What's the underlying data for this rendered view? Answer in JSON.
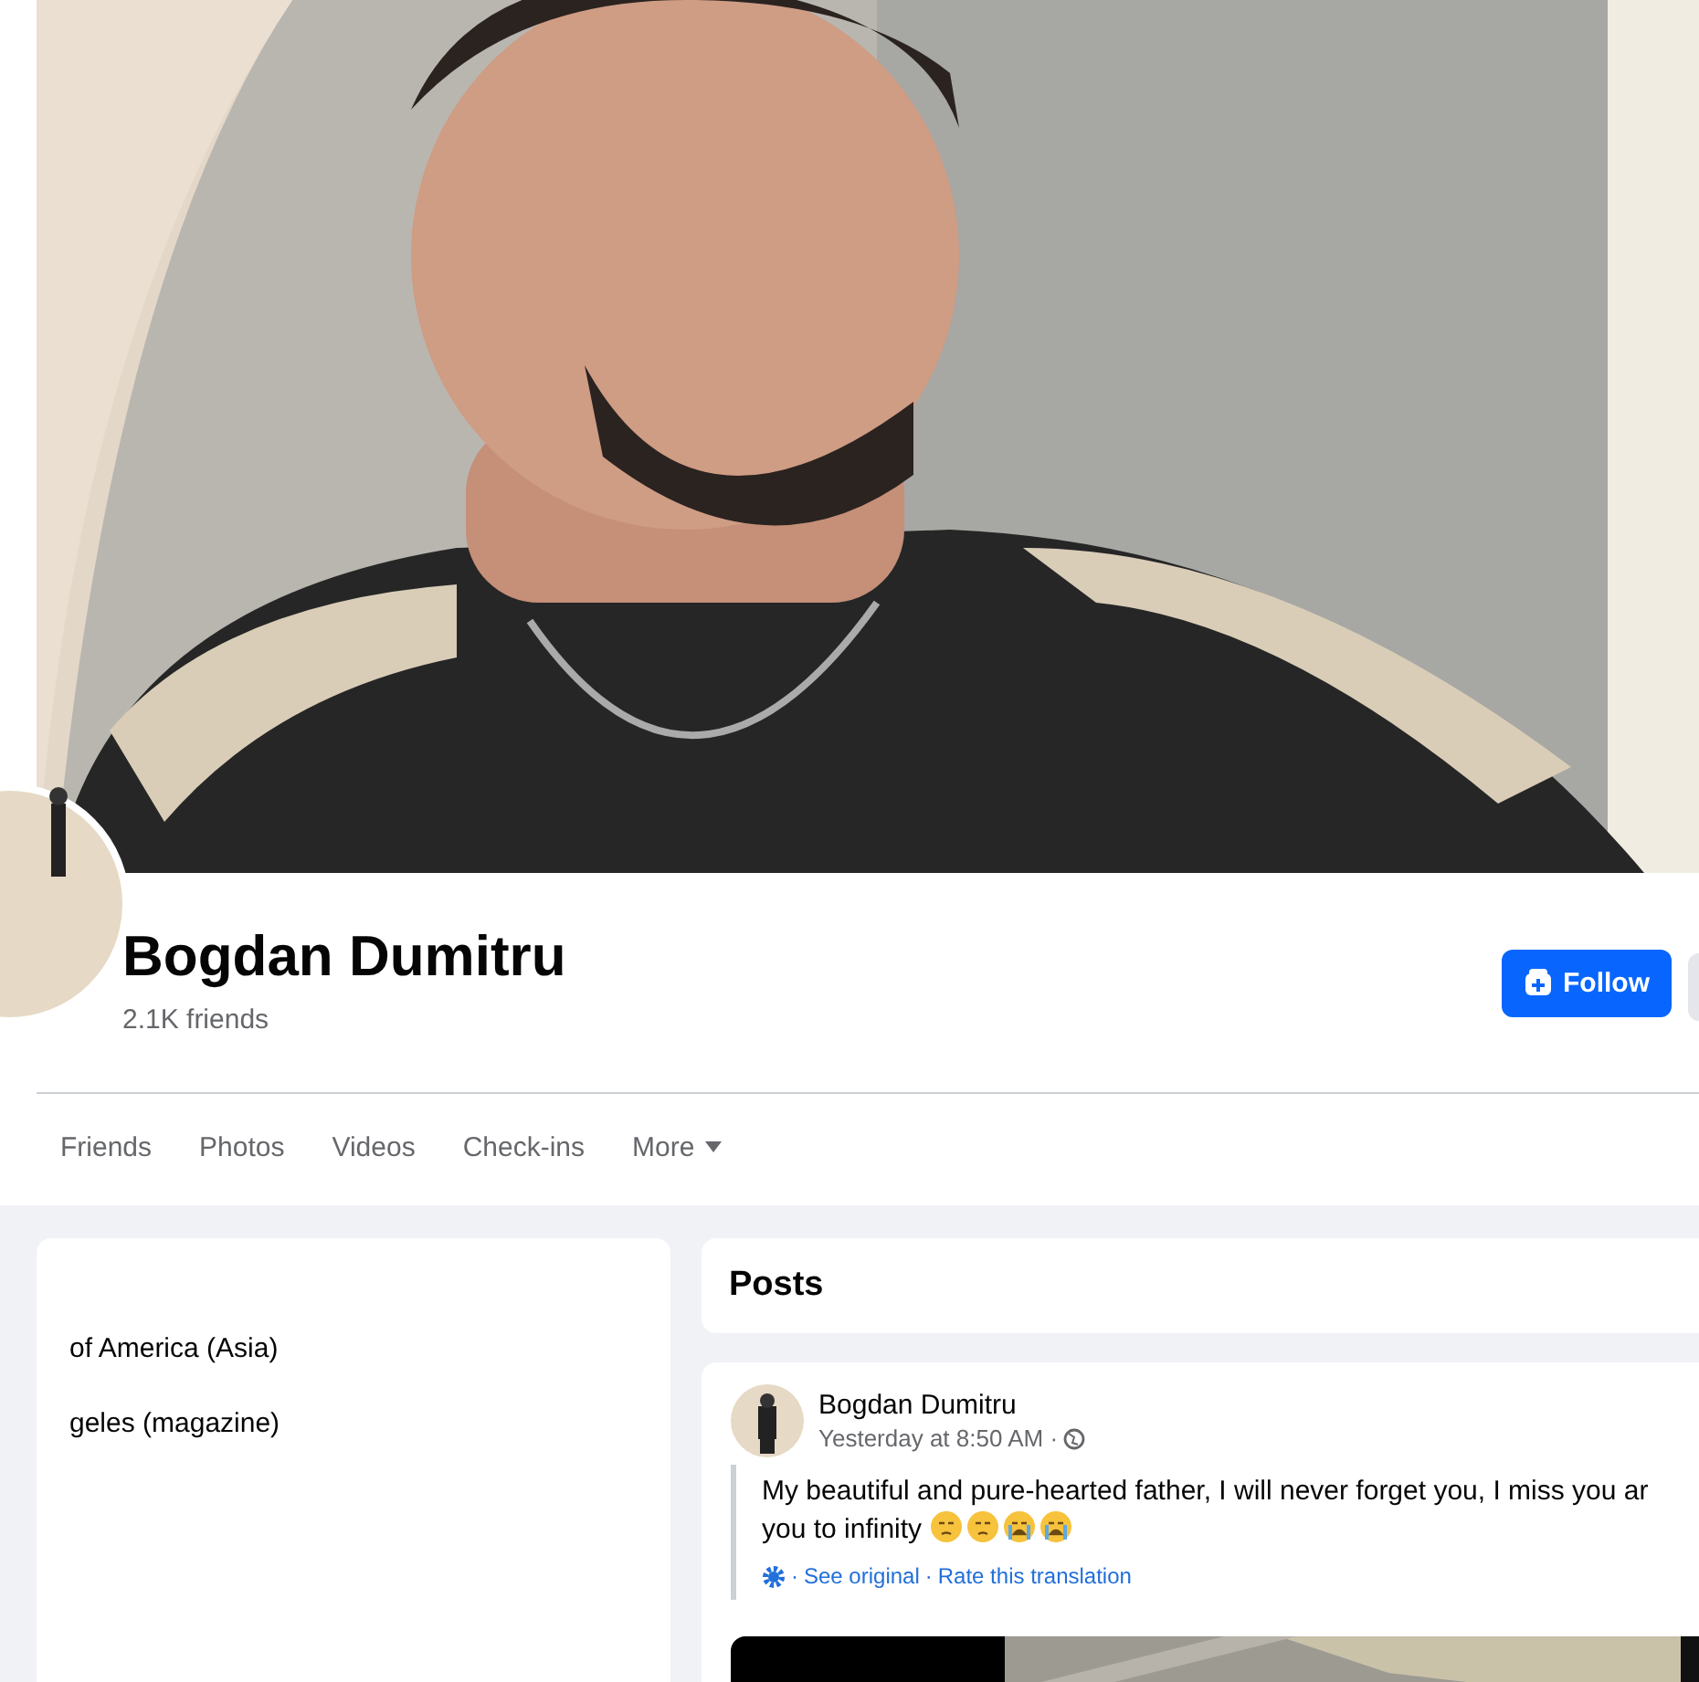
{
  "profile": {
    "name": "Bogdan Dumitru",
    "friends": "2.1K friends",
    "follow_button": "Follow"
  },
  "tabs": [
    {
      "label": "Friends",
      "selected": false
    },
    {
      "label": "Photos",
      "selected": false
    },
    {
      "label": "Videos",
      "selected": false
    },
    {
      "label": "Check-ins",
      "selected": false
    },
    {
      "label": "More",
      "selected": false,
      "kind": "menu"
    }
  ],
  "intro": {
    "lines": [
      "of America (Asia)",
      "geles (magazine)"
    ]
  },
  "posts_header": "Posts",
  "post": {
    "author": "Bogdan Dumitru",
    "time": "Yesterday at 8:50 AM ·",
    "text_lines": [
      "My beautiful and pure-hearted father, I will never forget you, I miss you ar",
      "you to infinity"
    ],
    "separator": "·",
    "see_original": "See original",
    "rate_translation": "Rate this translation"
  }
}
